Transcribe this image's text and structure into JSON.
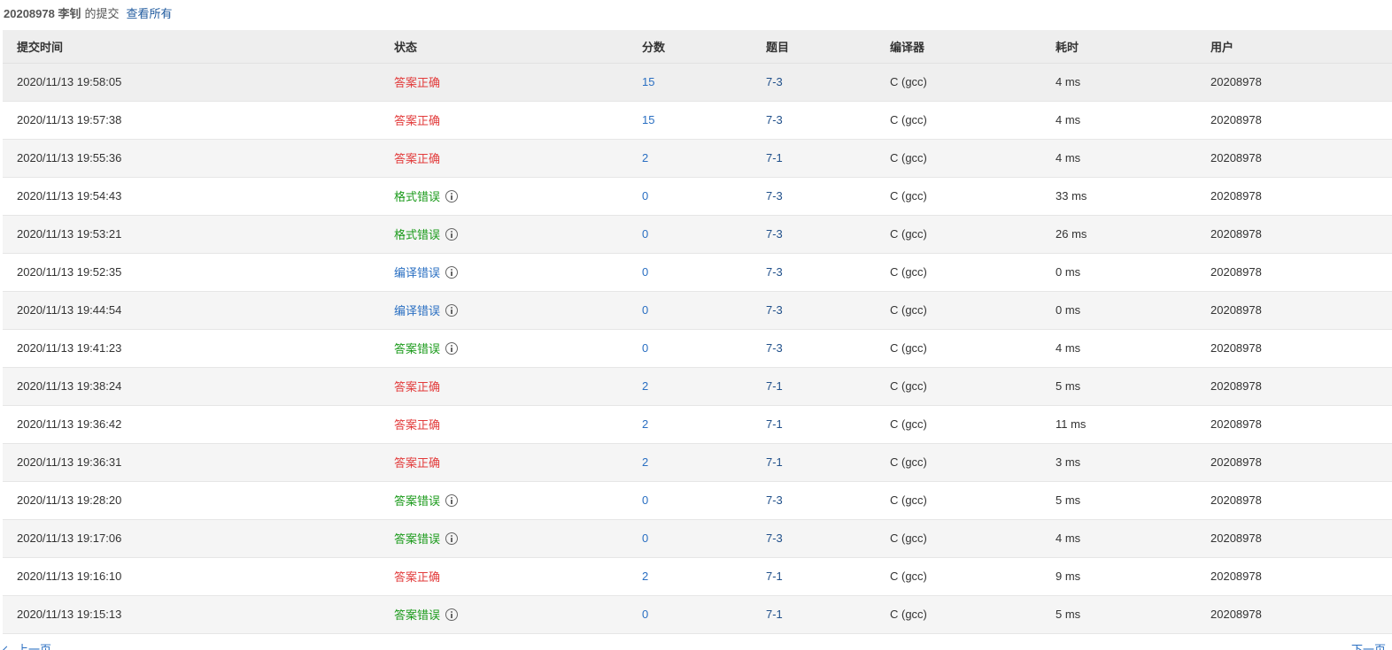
{
  "header": {
    "owner": "20208978 李钊",
    "suffix": "的提交",
    "view_all": "查看所有"
  },
  "columns": {
    "time": "提交时间",
    "status": "状态",
    "score": "分数",
    "problem": "题目",
    "compiler": "编译器",
    "duration": "耗时",
    "user": "用户"
  },
  "rows": [
    {
      "time": "2020/11/13 19:58:05",
      "status": "答案正确",
      "status_type": "accepted",
      "score": "15",
      "problem": "7-3",
      "compiler": "C (gcc)",
      "duration": "4 ms",
      "user": "20208978"
    },
    {
      "time": "2020/11/13 19:57:38",
      "status": "答案正确",
      "status_type": "accepted",
      "score": "15",
      "problem": "7-3",
      "compiler": "C (gcc)",
      "duration": "4 ms",
      "user": "20208978"
    },
    {
      "time": "2020/11/13 19:55:36",
      "status": "答案正确",
      "status_type": "accepted",
      "score": "2",
      "problem": "7-1",
      "compiler": "C (gcc)",
      "duration": "4 ms",
      "user": "20208978"
    },
    {
      "time": "2020/11/13 19:54:43",
      "status": "格式错误",
      "status_type": "format",
      "score": "0",
      "problem": "7-3",
      "compiler": "C (gcc)",
      "duration": "33 ms",
      "user": "20208978"
    },
    {
      "time": "2020/11/13 19:53:21",
      "status": "格式错误",
      "status_type": "format",
      "score": "0",
      "problem": "7-3",
      "compiler": "C (gcc)",
      "duration": "26 ms",
      "user": "20208978"
    },
    {
      "time": "2020/11/13 19:52:35",
      "status": "编译错误",
      "status_type": "compile",
      "score": "0",
      "problem": "7-3",
      "compiler": "C (gcc)",
      "duration": "0 ms",
      "user": "20208978"
    },
    {
      "time": "2020/11/13 19:44:54",
      "status": "编译错误",
      "status_type": "compile",
      "score": "0",
      "problem": "7-3",
      "compiler": "C (gcc)",
      "duration": "0 ms",
      "user": "20208978"
    },
    {
      "time": "2020/11/13 19:41:23",
      "status": "答案错误",
      "status_type": "wrong",
      "score": "0",
      "problem": "7-3",
      "compiler": "C (gcc)",
      "duration": "4 ms",
      "user": "20208978"
    },
    {
      "time": "2020/11/13 19:38:24",
      "status": "答案正确",
      "status_type": "accepted",
      "score": "2",
      "problem": "7-1",
      "compiler": "C (gcc)",
      "duration": "5 ms",
      "user": "20208978"
    },
    {
      "time": "2020/11/13 19:36:42",
      "status": "答案正确",
      "status_type": "accepted",
      "score": "2",
      "problem": "7-1",
      "compiler": "C (gcc)",
      "duration": "11 ms",
      "user": "20208978"
    },
    {
      "time": "2020/11/13 19:36:31",
      "status": "答案正确",
      "status_type": "accepted",
      "score": "2",
      "problem": "7-1",
      "compiler": "C (gcc)",
      "duration": "3 ms",
      "user": "20208978"
    },
    {
      "time": "2020/11/13 19:28:20",
      "status": "答案错误",
      "status_type": "wrong",
      "score": "0",
      "problem": "7-3",
      "compiler": "C (gcc)",
      "duration": "5 ms",
      "user": "20208978"
    },
    {
      "time": "2020/11/13 19:17:06",
      "status": "答案错误",
      "status_type": "wrong",
      "score": "0",
      "problem": "7-3",
      "compiler": "C (gcc)",
      "duration": "4 ms",
      "user": "20208978"
    },
    {
      "time": "2020/11/13 19:16:10",
      "status": "答案正确",
      "status_type": "accepted",
      "score": "2",
      "problem": "7-1",
      "compiler": "C (gcc)",
      "duration": "9 ms",
      "user": "20208978"
    },
    {
      "time": "2020/11/13 19:15:13",
      "status": "答案错误",
      "status_type": "wrong",
      "score": "0",
      "problem": "7-1",
      "compiler": "C (gcc)",
      "duration": "5 ms",
      "user": "20208978"
    }
  ],
  "pagination": {
    "prev": "上一页",
    "next": "下一页"
  },
  "colors": {
    "accepted": "#e23b3b",
    "format_error": "#1a9a1a",
    "wrong_answer": "#1a9a1a",
    "compile_error": "#2a6fc2",
    "link": "#2a6fc2"
  },
  "icons": {
    "status_detail": "info-circle-icon",
    "prev": "chevron-left-icon"
  }
}
